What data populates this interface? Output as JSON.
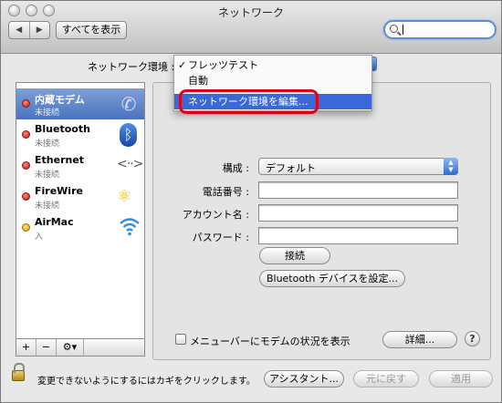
{
  "window": {
    "title": "ネットワーク"
  },
  "toolbar": {
    "back": "◀",
    "forward": "▶",
    "show_all": "すべてを表示",
    "search_placeholder": ""
  },
  "location": {
    "label": "ネットワーク環境 :",
    "menu": [
      {
        "check": "✓",
        "label": "フレッツテスト"
      },
      {
        "check": "",
        "label": "自動"
      },
      {
        "check": "",
        "label": "ネットワーク環境を編集..."
      }
    ]
  },
  "sidebar": {
    "items": [
      {
        "name": "内蔵モデム",
        "status": "未接続",
        "icon": "phone-modem-icon",
        "status_color": "#c0140a"
      },
      {
        "name": "Bluetooth",
        "status": "未接続",
        "icon": "bluetooth-icon",
        "status_color": "#c0140a"
      },
      {
        "name": "Ethernet",
        "status": "未接続",
        "icon": "ethernet-icon",
        "status_color": "#c0140a"
      },
      {
        "name": "FireWire",
        "status": "未接続",
        "icon": "firewire-icon",
        "status_color": "#c0140a"
      },
      {
        "name": "AirMac",
        "status": "入",
        "icon": "wifi-icon",
        "status_color": "#e09a0a"
      }
    ],
    "add": "+",
    "remove": "−",
    "action": "⚙▾"
  },
  "detail": {
    "config_label": "構成 :",
    "config_value": "デフォルト",
    "phone_label": "電話番号 :",
    "phone_value": "",
    "account_label": "アカウント名 :",
    "account_value": "",
    "password_label": "パスワード :",
    "password_value": "",
    "connect_button": "接続",
    "bluetooth_button": "Bluetooth デバイスを設定...",
    "menubar_checkbox": "メニューバーにモデムの状況を表示",
    "advanced_button": "詳細...",
    "help": "?"
  },
  "footer": {
    "lock_text": "変更できないようにするにはカギをクリックします。",
    "assistant_button": "アシスタント...",
    "revert_button": "元に戻す",
    "apply_button": "適用"
  }
}
